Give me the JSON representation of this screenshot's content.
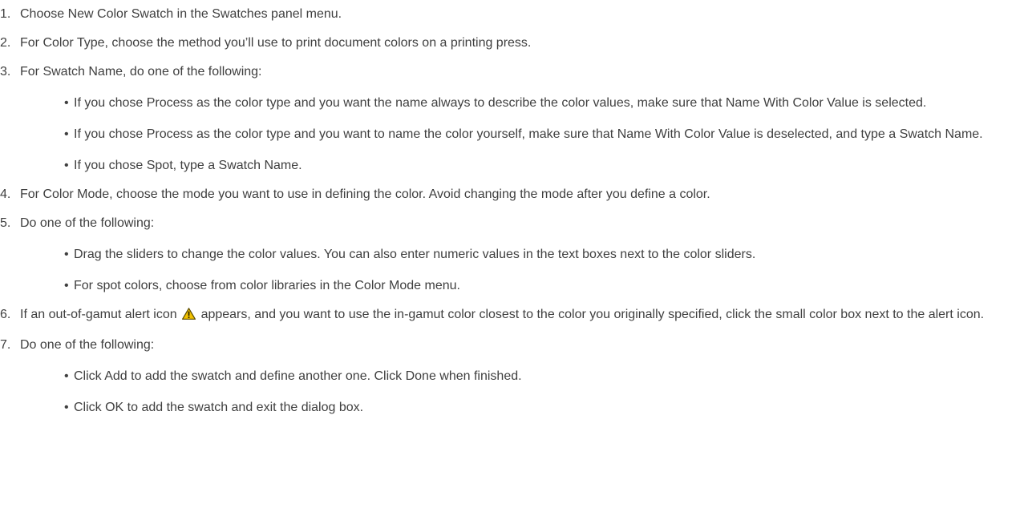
{
  "steps": [
    {
      "num": "1.",
      "text": "Choose New Color Swatch in the Swatches panel menu."
    },
    {
      "num": "2.",
      "text": "For Color Type, choose the method you’ll use to print document colors on a printing press."
    },
    {
      "num": "3.",
      "text": "For Swatch Name, do one of the following:",
      "subs": [
        "If you chose Process as the color type and you want the name always to describe the color values, make sure that Name With Color Value is selected.",
        "If you chose Process as the color type and you want to name the color yourself, make sure that Name With Color Value is deselected, and type a Swatch Name.",
        "If you chose Spot, type a Swatch Name."
      ]
    },
    {
      "num": "4.",
      "text": "For Color Mode, choose the mode you want to use in defining the color. Avoid changing the mode after you define a color."
    },
    {
      "num": "5.",
      "text": "Do one of the following:",
      "subs": [
        "Drag the sliders to change the color values. You can also enter numeric values in the text boxes next to the color sliders.",
        "For spot colors, choose from color libraries in the Color Mode menu."
      ]
    },
    {
      "num": "6.",
      "text_before_icon": "If an out-of-gamut alert icon",
      "icon": "warning-icon",
      "text_after_icon": "appears, and you want to use the in-gamut color closest to the color you originally specified, click the small color box next to the alert icon."
    },
    {
      "num": "7.",
      "text": "Do one of the following:",
      "subs": [
        "Click Add to add the swatch and define another one. Click Done when finished.",
        "Click OK to add the swatch and exit the dialog box."
      ]
    }
  ],
  "bullet_char": "•",
  "colors": {
    "text": "#3f3f3f",
    "warning_fill": "#f2c200",
    "warning_outline": "#5a4a00"
  }
}
